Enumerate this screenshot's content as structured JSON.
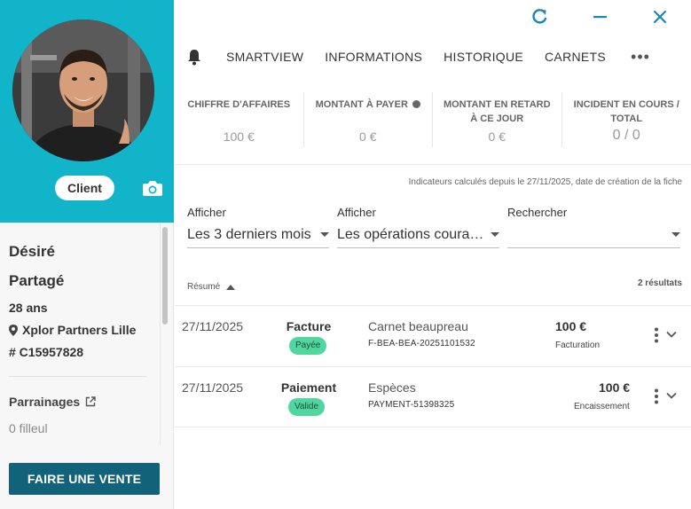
{
  "profile": {
    "badge": "Client",
    "first_name": "Désiré",
    "last_name": "Partagé",
    "age": "28 ans",
    "location": "Xplor Partners Lille",
    "id": "# C15957828",
    "referrals_label": "Parrainages",
    "referrals_value": "0 filleul",
    "sale_button": "FAIRE UNE VENTE"
  },
  "tabs": [
    "SMARTVIEW",
    "INFORMATIONS",
    "HISTORIQUE",
    "CARNETS"
  ],
  "more_label": "•••",
  "kpis": [
    {
      "label": "CHIFFRE D'AFFAIRES",
      "value": "100 €"
    },
    {
      "label": "MONTANT À PAYER",
      "value": "0 €"
    },
    {
      "label": "MONTANT EN RETARD À CE JOUR",
      "value": "0 €"
    },
    {
      "label": "INCIDENT EN COURS / TOTAL",
      "value": "0 / 0"
    }
  ],
  "indicator_note": "Indicateurs calculés depuis le 27/11/2025, date de création de la fiche",
  "filters": [
    {
      "label": "Afficher",
      "value": "Les 3 derniers mois"
    },
    {
      "label": "Afficher",
      "value": "Les opérations coura…"
    },
    {
      "label": "Rechercher",
      "value": ""
    }
  ],
  "list": {
    "sort_label": "Résumé",
    "results": "2 résultats",
    "rows": [
      {
        "date": "27/11/2025",
        "type": "Facture",
        "status": "Payée",
        "description": "Carnet beaupreau",
        "reference": "F-BEA-BEA-20251101532",
        "amount": "100 €",
        "category": "Facturation"
      },
      {
        "date": "27/11/2025",
        "type": "Paiement",
        "status": "Valide",
        "description": "Espèces",
        "reference": "PAYMENT-51398325",
        "amount": "100 €",
        "category": "Encaissement"
      }
    ]
  },
  "colors": {
    "accent": "#12b4c9",
    "primary_button": "#12627a",
    "badge_green": "#52d6a0",
    "window_icons": "#1a86b8"
  }
}
